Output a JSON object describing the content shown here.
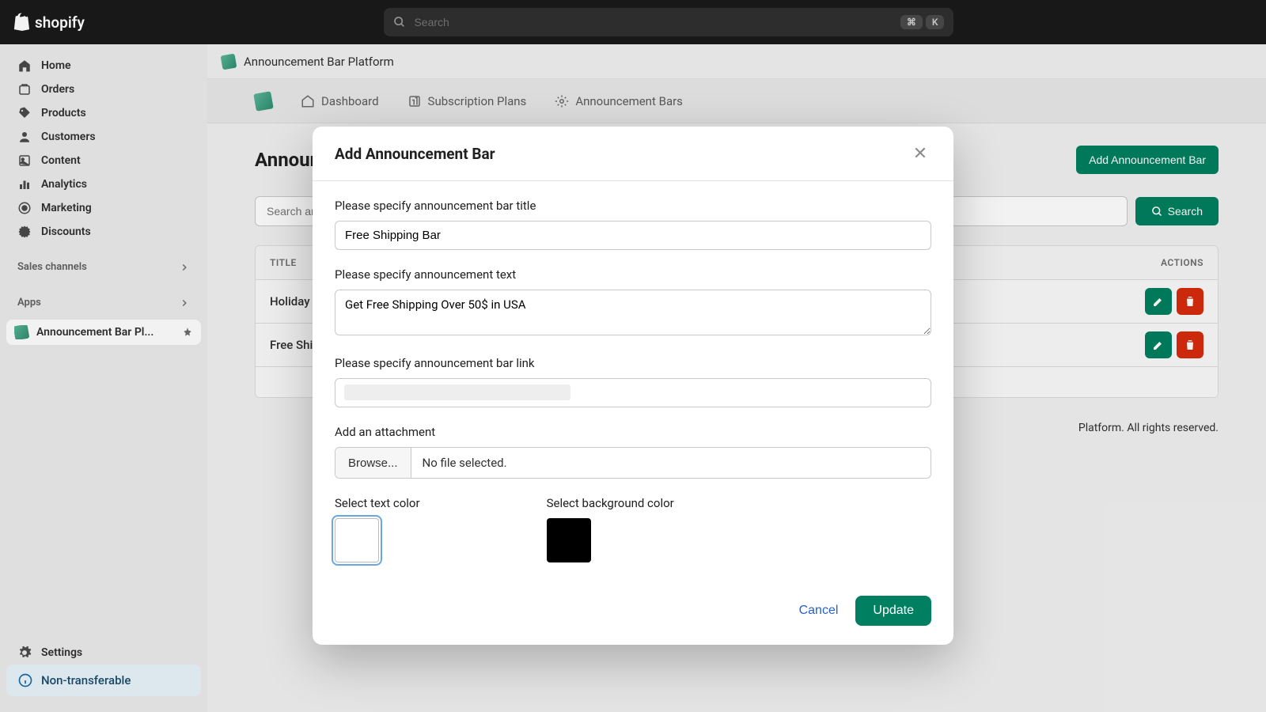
{
  "brand": "shopify",
  "search": {
    "placeholder": "Search",
    "shortcut1": "⌘",
    "shortcut2": "K"
  },
  "sidebar": {
    "items": [
      {
        "label": "Home"
      },
      {
        "label": "Orders"
      },
      {
        "label": "Products"
      },
      {
        "label": "Customers"
      },
      {
        "label": "Content"
      },
      {
        "label": "Analytics"
      },
      {
        "label": "Marketing"
      },
      {
        "label": "Discounts"
      }
    ],
    "sales_channels_label": "Sales channels",
    "apps_label": "Apps",
    "current_app": "Announcement Bar Pl...",
    "settings_label": "Settings",
    "non_transferable": "Non-transferable"
  },
  "breadcrumb": {
    "app_name": "Announcement Bar Platform"
  },
  "tabs": [
    {
      "label": "Dashboard"
    },
    {
      "label": "Subscription Plans"
    },
    {
      "label": "Announcement Bars"
    }
  ],
  "page": {
    "title": "Announcement Bars",
    "add_button": "Add Announcement Bar",
    "search_placeholder": "Search announcement bar",
    "search_button": "Search",
    "columns": {
      "title": "TITLE",
      "actions": "ACTIONS"
    },
    "rows": [
      {
        "title": "Holiday Bar"
      },
      {
        "title": "Free Shipping Bar"
      }
    ],
    "footer": "Platform. All rights reserved."
  },
  "modal": {
    "title": "Add Announcement Bar",
    "label_title": "Please specify announcement bar title",
    "value_title": "Free Shipping Bar",
    "label_text": "Please specify announcement text",
    "value_text": "Get Free Shipping Over 50$ in USA",
    "label_link": "Please specify announcement bar link",
    "value_link": "",
    "label_attachment": "Add an attachment",
    "browse_label": "Browse...",
    "file_selected": "No file selected.",
    "label_text_color": "Select text color",
    "label_bg_color": "Select background color",
    "text_color": "#ffffff",
    "bg_color": "#000000",
    "cancel_label": "Cancel",
    "update_label": "Update"
  }
}
